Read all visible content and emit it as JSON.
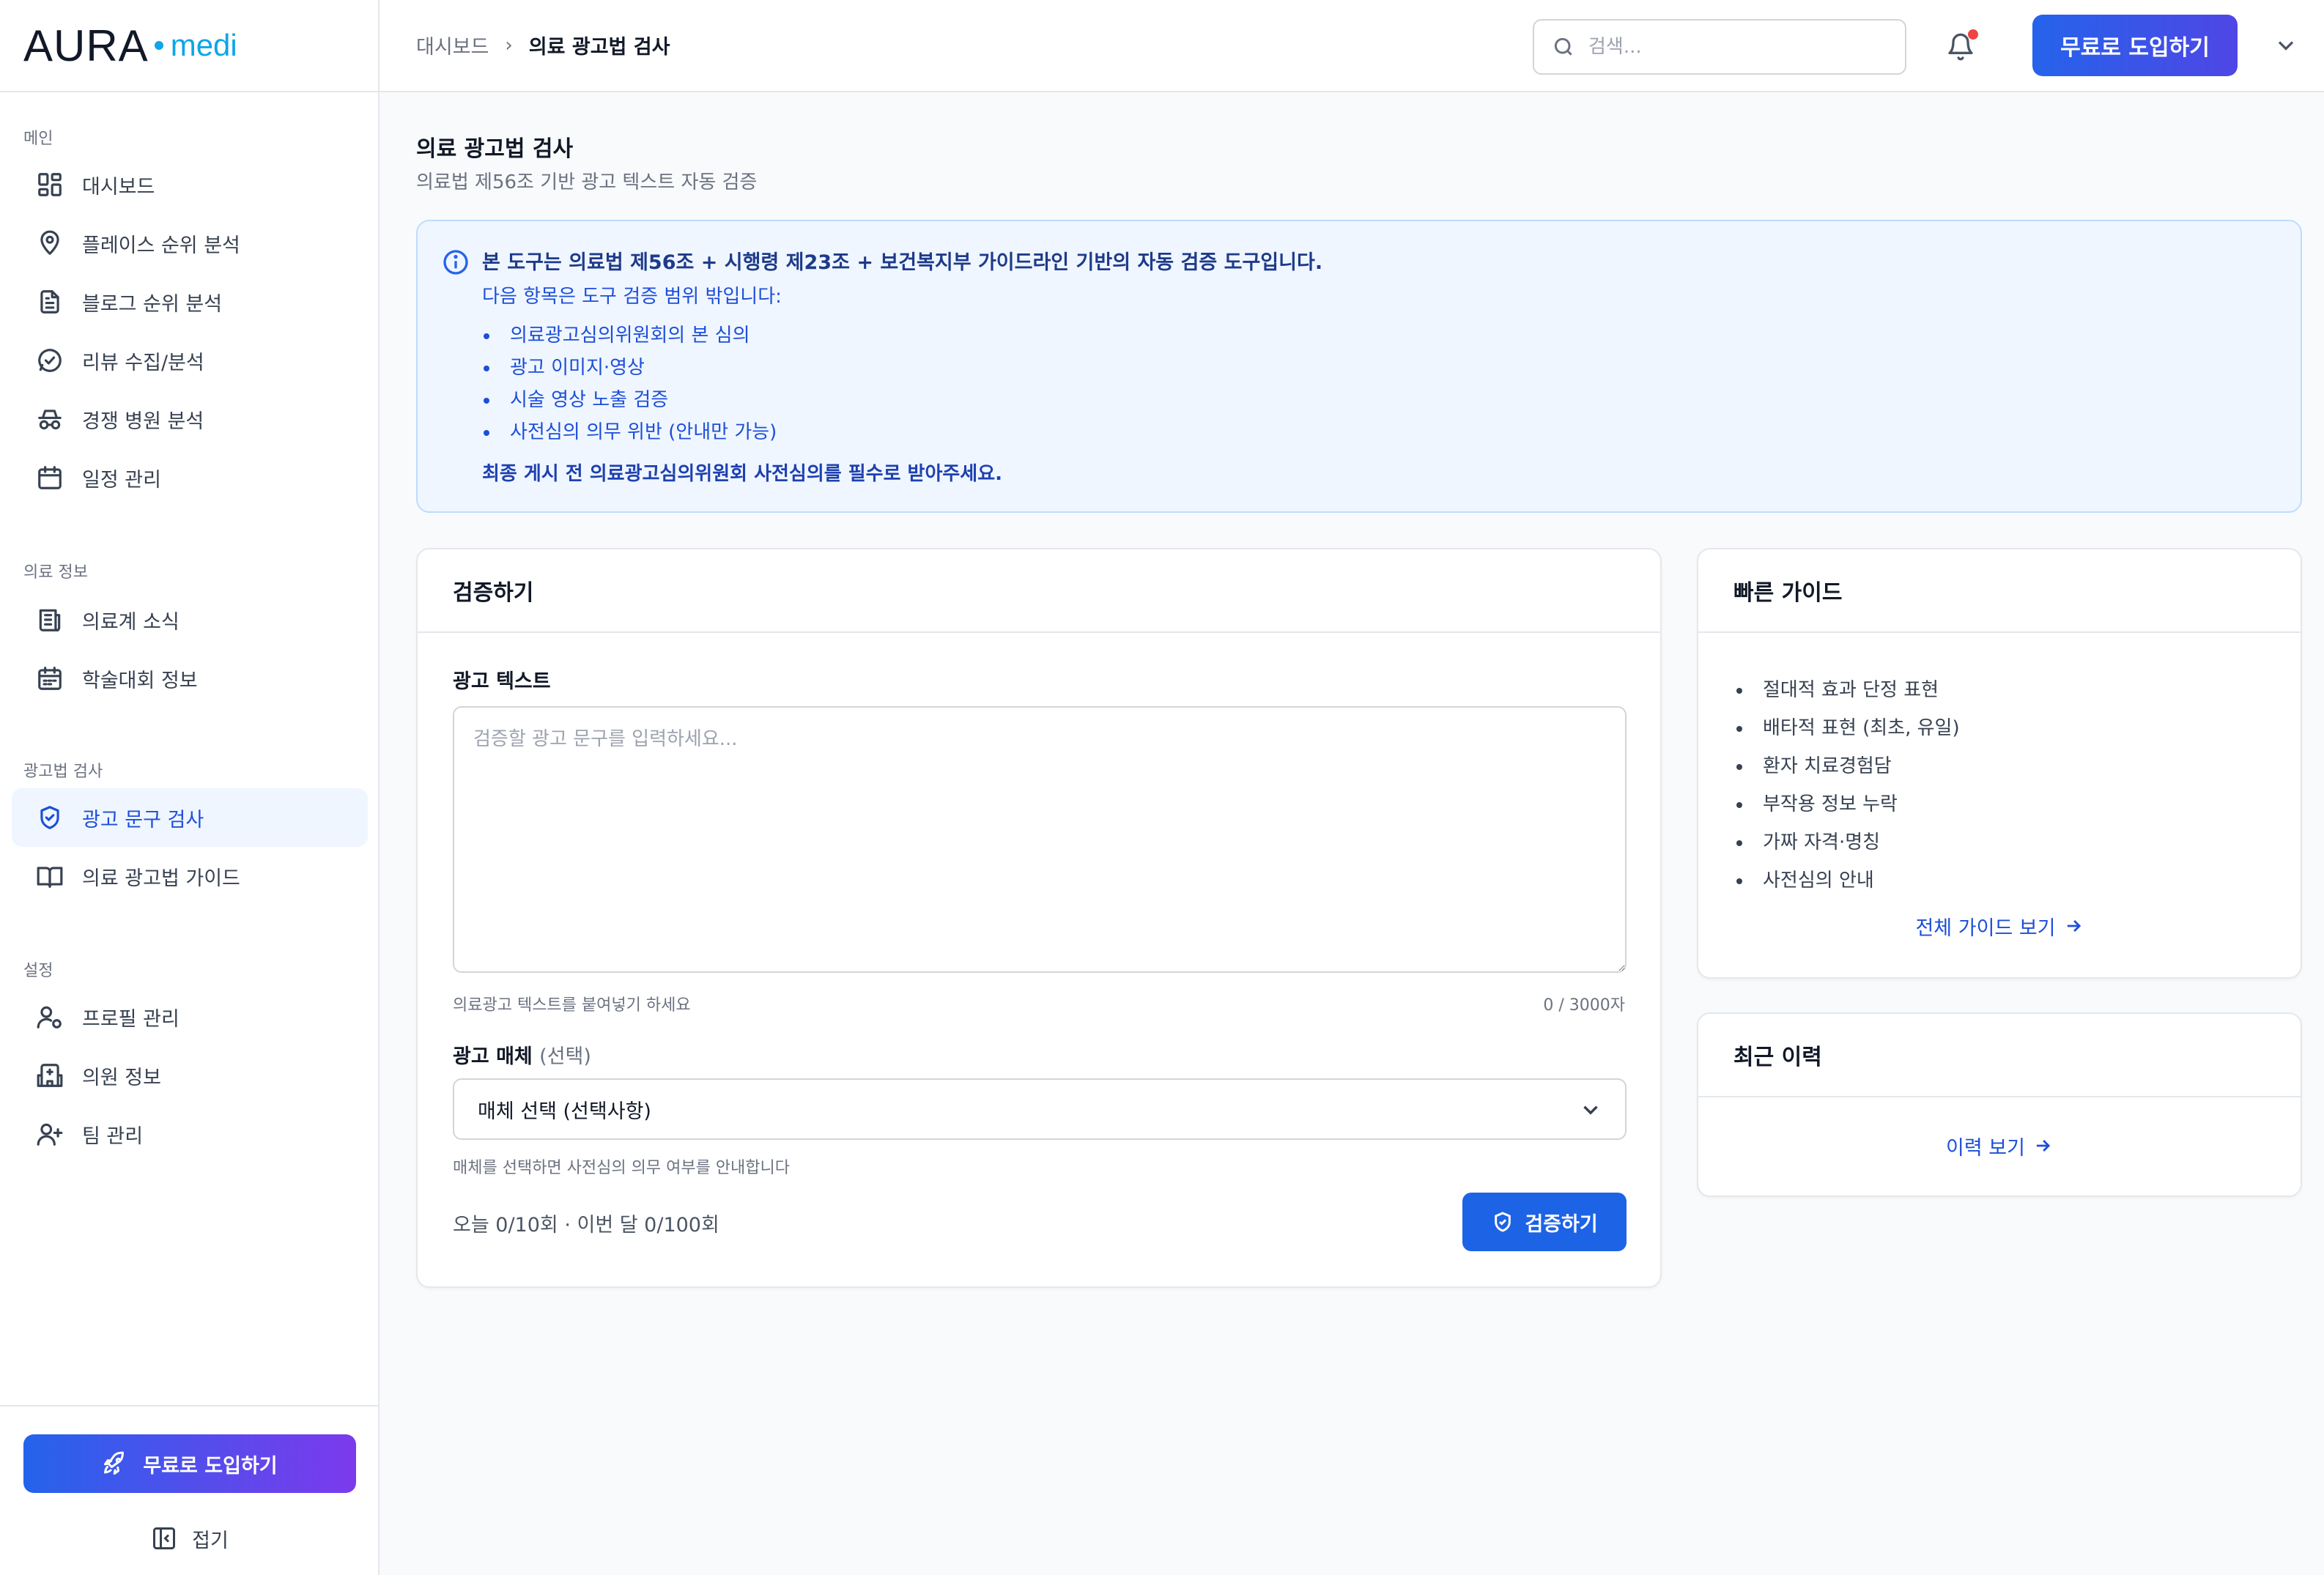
{
  "brand": {
    "name": "AURA",
    "sub": "medi"
  },
  "sidebar": {
    "sections": [
      {
        "heading": "메인",
        "items": [
          {
            "label": "대시보드",
            "icon": "dashboard-icon"
          },
          {
            "label": "플레이스 순위 분석",
            "icon": "map-pin-icon"
          },
          {
            "label": "블로그 순위 분석",
            "icon": "document-icon"
          },
          {
            "label": "리뷰 수집/분석",
            "icon": "chat-check-icon"
          },
          {
            "label": "경쟁 병원 분석",
            "icon": "spy-icon"
          },
          {
            "label": "일정 관리",
            "icon": "calendar-icon"
          }
        ]
      },
      {
        "heading": "의료 정보",
        "items": [
          {
            "label": "의료계 소식",
            "icon": "newspaper-icon"
          },
          {
            "label": "학술대회 정보",
            "icon": "calendar-grid-icon"
          }
        ]
      },
      {
        "heading": "광고법 검사",
        "items": [
          {
            "label": "광고 문구 검사",
            "icon": "shield-check-icon",
            "active": true
          },
          {
            "label": "의료 광고법 가이드",
            "icon": "book-icon"
          }
        ]
      },
      {
        "heading": "설정",
        "items": [
          {
            "label": "프로필 관리",
            "icon": "user-settings-icon"
          },
          {
            "label": "의원 정보",
            "icon": "hospital-icon"
          },
          {
            "label": "팀 관리",
            "icon": "user-plus-icon"
          }
        ]
      }
    ],
    "cta_label": "무료로 도입하기",
    "collapse_label": "접기"
  },
  "header": {
    "breadcrumb_home": "대시보드",
    "breadcrumb_current": "의료 광고법 검사",
    "search_placeholder": "검색...",
    "cta_label": "무료로 도입하기"
  },
  "page": {
    "title": "의료 광고법 검사",
    "subtitle": "의료법 제56조 기반 광고 텍스트 자동 검증"
  },
  "notice": {
    "headline": "본 도구는 의료법 제56조 + 시행령 제23조 + 보건복지부 가이드라인 기반의 자동 검증 도구입니다.",
    "intro": "다음 항목은 도구 검증 범위 밖입니다:",
    "items": [
      "의료광고심의위원회의 본 심의",
      "광고 이미지·영상",
      "시술 영상 노출 검증",
      "사전심의 의무 위반 (안내만 가능)"
    ],
    "footer": "최종 게시 전 의료광고심의위원회 사전심의를 필수로 받아주세요."
  },
  "verify": {
    "card_title": "검증하기",
    "text_label": "광고 텍스트",
    "text_placeholder": "검증할 광고 문구를 입력하세요...",
    "text_value": "",
    "text_hint": "의료광고 텍스트를 붙여넣기 하세요",
    "char_count": "0 / 3000자",
    "media_label": "광고 매체",
    "media_optional": "(선택)",
    "media_selected": "매체 선택 (선택사항)",
    "media_hint": "매체를 선택하면 사전심의 의무 여부를 안내합니다",
    "quota": "오늘 0/10회 · 이번 달 0/100회",
    "button_label": "검증하기"
  },
  "guide": {
    "title": "빠른 가이드",
    "items": [
      "절대적 효과 단정 표현",
      "배타적 표현 (최초, 유일)",
      "환자 치료경험담",
      "부작용 정보 누락",
      "가짜 자격·명칭",
      "사전심의 안내"
    ],
    "link_label": "전체 가이드 보기"
  },
  "history": {
    "title": "최근 이력",
    "link_label": "이력 보기"
  },
  "colors": {
    "primary": "#1d63e6",
    "gradient_start": "#2563eb",
    "gradient_end": "#7c3aed",
    "notice_bg": "#eff6ff",
    "badge": "#ef4444"
  }
}
